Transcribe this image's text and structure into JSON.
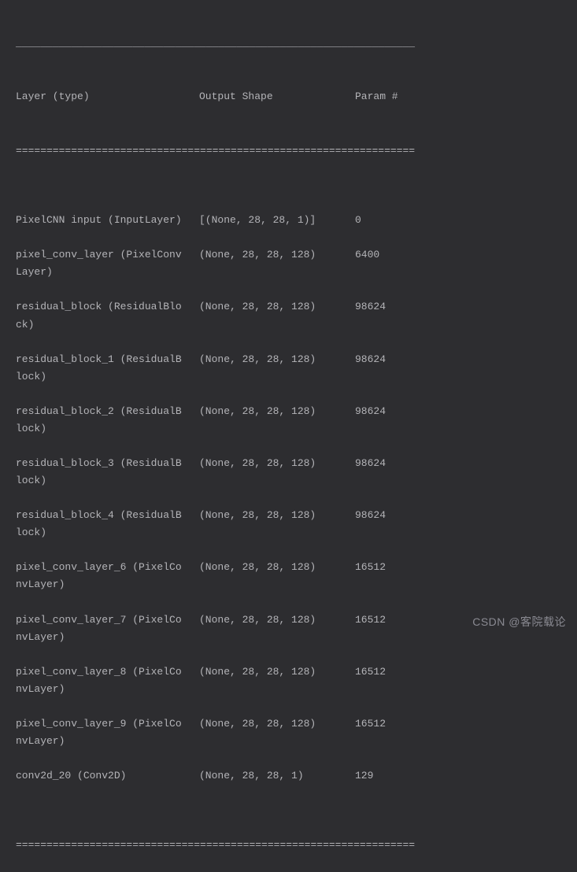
{
  "dividers": {
    "dash": "_________________________________________________________________",
    "equal": "================================================================="
  },
  "header": {
    "col1": "Layer (type)",
    "col2": "Output Shape",
    "col3": "Param #"
  },
  "rows": [
    {
      "name_l1": "PixelCNN input (InputLayer)",
      "name_l2": "",
      "shape": "[(None, 28, 28, 1)]",
      "params": "0"
    },
    {
      "name_l1": "pixel_conv_layer (PixelConv",
      "name_l2": "Layer)",
      "shape": "(None, 28, 28, 128)",
      "params": "6400"
    },
    {
      "name_l1": "residual_block (ResidualBlo",
      "name_l2": "ck)",
      "shape": "(None, 28, 28, 128)",
      "params": "98624"
    },
    {
      "name_l1": "residual_block_1 (ResidualB",
      "name_l2": "lock)",
      "shape": "(None, 28, 28, 128)",
      "params": "98624"
    },
    {
      "name_l1": "residual_block_2 (ResidualB",
      "name_l2": "lock)",
      "shape": "(None, 28, 28, 128)",
      "params": "98624"
    },
    {
      "name_l1": "residual_block_3 (ResidualB",
      "name_l2": "lock)",
      "shape": "(None, 28, 28, 128)",
      "params": "98624"
    },
    {
      "name_l1": "residual_block_4 (ResidualB",
      "name_l2": "lock)",
      "shape": "(None, 28, 28, 128)",
      "params": "98624"
    },
    {
      "name_l1": "pixel_conv_layer_6 (PixelCo",
      "name_l2": "nvLayer)",
      "shape": "(None, 28, 28, 128)",
      "params": "16512"
    },
    {
      "name_l1": "pixel_conv_layer_7 (PixelCo",
      "name_l2": "nvLayer)",
      "shape": "(None, 28, 28, 128)",
      "params": "16512"
    },
    {
      "name_l1": "pixel_conv_layer_8 (PixelCo",
      "name_l2": "nvLayer)",
      "shape": "(None, 28, 28, 128)",
      "params": "16512"
    },
    {
      "name_l1": "pixel_conv_layer_9 (PixelCo",
      "name_l2": "nvLayer)",
      "shape": "(None, 28, 28, 128)",
      "params": "16512"
    },
    {
      "name_l1": "conv2d_20 (Conv2D)",
      "name_l2": "",
      "shape": "(None, 28, 28, 1)",
      "params": "129"
    }
  ],
  "watermark": "CSDN @客院载论"
}
